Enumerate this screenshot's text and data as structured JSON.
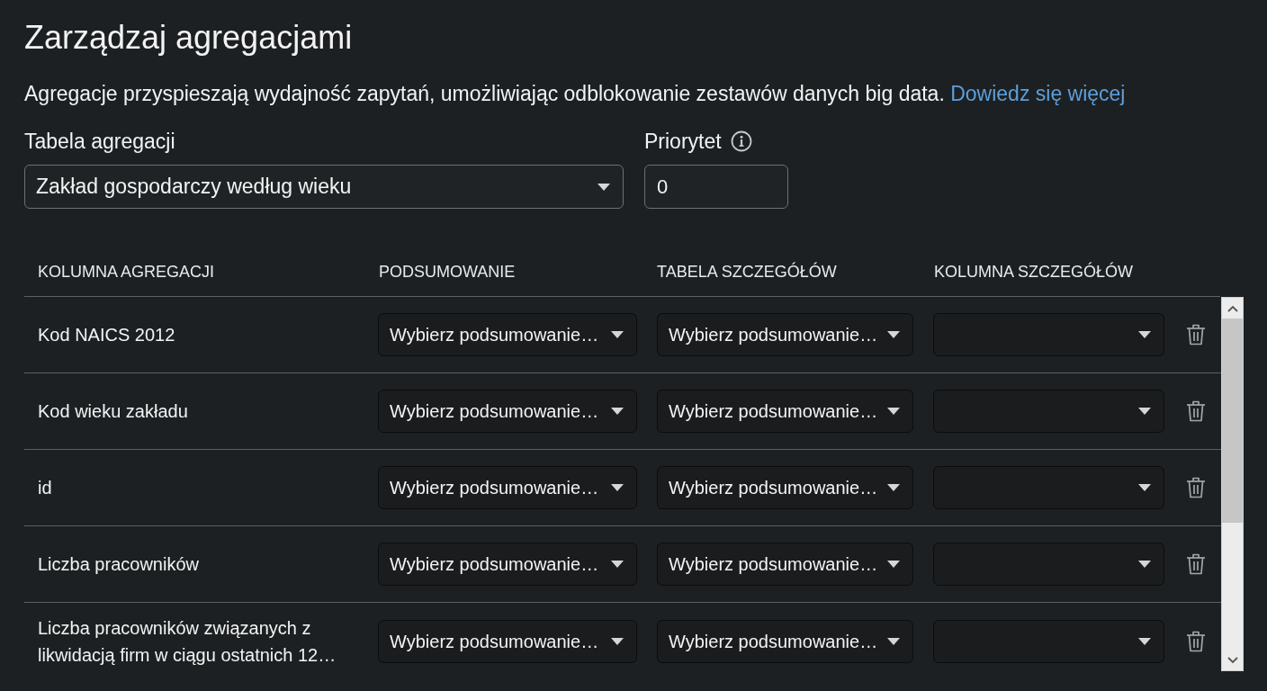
{
  "page_title": "Zarządzaj agregacjami",
  "description": {
    "text": "Agregacje przyspieszają wydajność zapytań, umożliwiając odblokowanie zestawów danych big data.",
    "link": "Dowiedz się więcej"
  },
  "aggregation_table": {
    "label": "Tabela agregacji",
    "value": "Zakład gospodarczy według wieku"
  },
  "priority": {
    "label": "Priorytet",
    "value": "0"
  },
  "table": {
    "columns": [
      "KOLUMNA AGREGACJI",
      "PODSUMOWANIE",
      "TABELA SZCZEGÓŁÓW",
      "KOLUMNA SZCZEGÓŁÓW"
    ],
    "rows": [
      {
        "aggregation_column": "Kod NAICS 2012",
        "summary": "Wybierz podsumowanie…",
        "detail_table": "Wybierz podsumowanie…"
      },
      {
        "aggregation_column": "Kod wieku zakładu",
        "summary": "Wybierz podsumowanie…",
        "detail_table": "Wybierz podsumowanie…"
      },
      {
        "aggregation_column": "id",
        "summary": "Wybierz podsumowanie…",
        "detail_table": "Wybierz podsumowanie…"
      },
      {
        "aggregation_column": "Liczba pracowników",
        "summary": "Wybierz podsumowanie…",
        "detail_table": "Wybierz podsumowanie…"
      },
      {
        "aggregation_column": "Liczba pracowników związanych z likwidacją firm w ciągu ostatnich 12…",
        "summary": "Wybierz podsumowanie…",
        "detail_table": "Wybierz podsumowanie…"
      }
    ]
  }
}
